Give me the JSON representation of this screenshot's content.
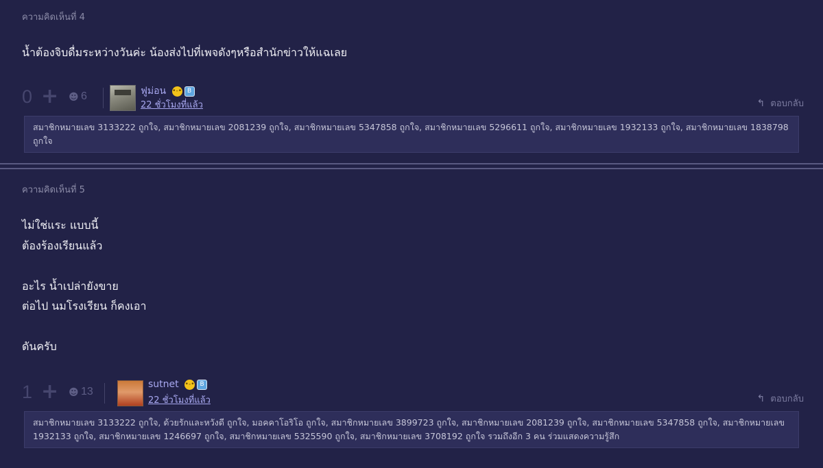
{
  "comments": [
    {
      "header": "ความคิดเห็นที่ 4",
      "body": "น้ำต้องจิบดื่มระหว่างวันค่ะ น้องส่งไปที่เพจดังๆหรือสำนักข่าวให้แฉเลย",
      "score": "0",
      "emotion_count": "6",
      "username": "ฟูม่อน",
      "time": "22 ชั่วโมงที่แล้ว",
      "reply_label": "ตอบกลับ",
      "likes_text": "สมาชิกหมายเลข 3133222 ถูกใจ, สมาชิกหมายเลข 2081239 ถูกใจ, สมาชิกหมายเลข 5347858 ถูกใจ, สมาชิกหมายเลข 5296611 ถูกใจ, สมาชิกหมายเลข 1932133 ถูกใจ, สมาชิกหมายเลข 1838798 ถูกใจ"
    },
    {
      "header": "ความคิดเห็นที่ 5",
      "body": "ไม่ใช่แระ แบบนี้\nต้องร้องเรียนแล้ว\n\nอะไร น้ำเปล่ายังขาย\nต่อไป นมโรงเรียน ก็คงเอา\n\nดันครับ",
      "score": "1",
      "emotion_count": "13",
      "username": "sutnet",
      "time": "22 ชั่วโมงที่แล้ว",
      "reply_label": "ตอบกลับ",
      "likes_text": "สมาชิกหมายเลข 3133222 ถูกใจ, ด้วยรักและหวังดี ถูกใจ, มอคคาโอริโอ ถูกใจ, สมาชิกหมายเลข 3899723 ถูกใจ, สมาชิกหมายเลข 2081239 ถูกใจ, สมาชิกหมายเลข 5347858 ถูกใจ, สมาชิกหมายเลข 1932133 ถูกใจ, สมาชิกหมายเลข 1246697 ถูกใจ, สมาชิกหมายเลข 5325590 ถูกใจ, สมาชิกหมายเลข 3708192 ถูกใจ รวมถึงอีก 3 คน ร่วมแสดงความรู้สึก"
    }
  ],
  "icons": {
    "plus": "+",
    "emotion": "☻",
    "user_emoji": "😑",
    "badge": "B",
    "reply": "↰"
  },
  "colors": {
    "background": "#222247",
    "link": "#a8a8f0",
    "likes_box": "#2e2e5a"
  }
}
